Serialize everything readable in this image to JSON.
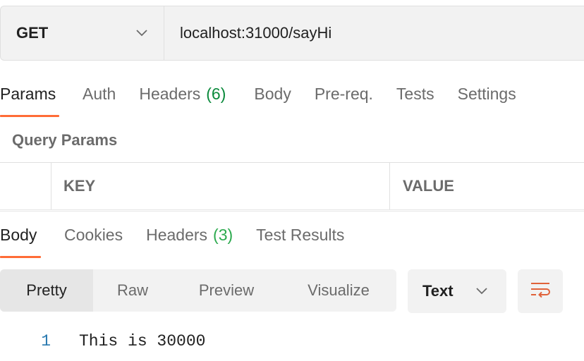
{
  "request": {
    "method": "GET",
    "url": "localhost:31000/sayHi"
  },
  "request_tabs": {
    "params": "Params",
    "auth": "Auth",
    "headers": "Headers",
    "headers_count": "(6)",
    "body": "Body",
    "prereq": "Pre-req.",
    "tests": "Tests",
    "settings": "Settings"
  },
  "query_params": {
    "title": "Query Params",
    "key_header": "KEY",
    "value_header": "VALUE"
  },
  "response_tabs": {
    "body": "Body",
    "cookies": "Cookies",
    "headers": "Headers",
    "headers_count": "(3)",
    "test_results": "Test Results"
  },
  "view_modes": [
    "Pretty",
    "Raw",
    "Preview",
    "Visualize"
  ],
  "format": "Text",
  "response_body": [
    {
      "line": "1",
      "text": "This is 30000"
    }
  ],
  "colors": {
    "accent": "#ff6c37",
    "count_green": "#0b8a3c",
    "line_number": "#2a7ab0"
  },
  "icons": {
    "method_chevron": "chevron-down-icon",
    "format_chevron": "chevron-down-icon",
    "wrap": "wrap-lines-icon"
  }
}
